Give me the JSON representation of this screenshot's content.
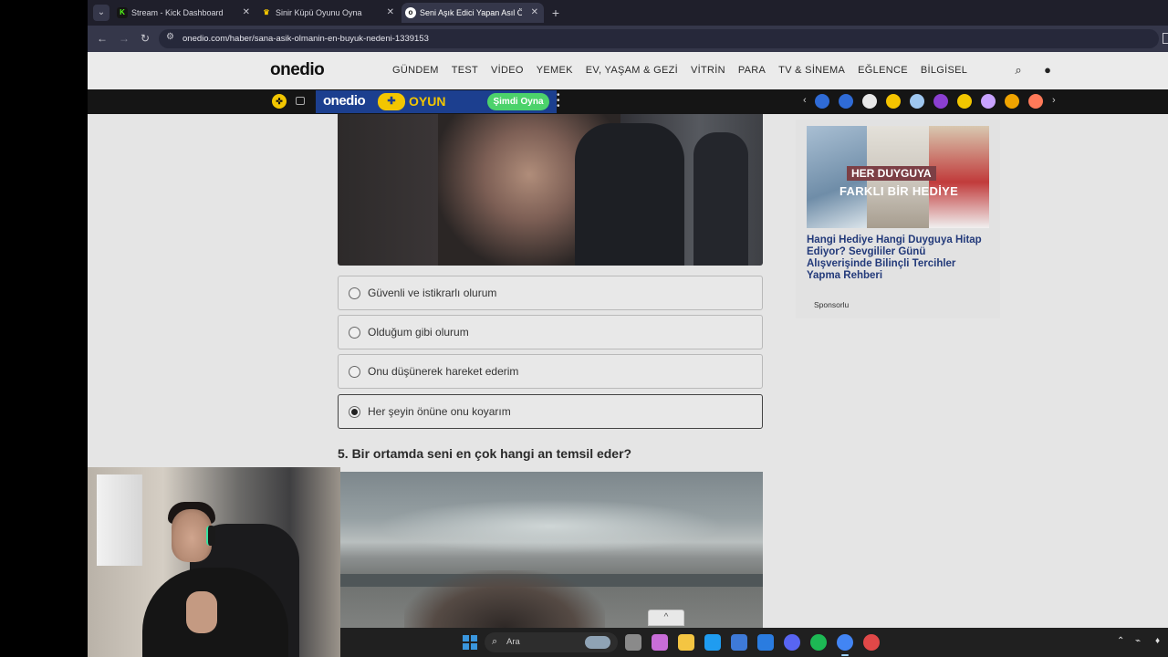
{
  "browser": {
    "tabs": [
      {
        "title": "Stream - Kick Dashboard",
        "favicon": "kick-icon",
        "favicon_color": "#53fc18",
        "active": false
      },
      {
        "title": "Sinir Küpü Oyunu Oyna",
        "favicon": "trophy-icon",
        "favicon_color": "#f2c600",
        "active": false
      },
      {
        "title": "Seni Aşık Edici Yapan Asıl Özelliğ",
        "favicon": "onedio-icon",
        "favicon_color": "#ffffff",
        "active": true
      }
    ],
    "url": "onedio.com/haber/sana-asik-olmanin-en-buyuk-nedeni-1339153"
  },
  "site": {
    "logo": "onedio",
    "nav": [
      "GÜNDEM",
      "TEST",
      "VİDEO",
      "YEMEK",
      "EV, YAŞAM & GEZİ",
      "VİTRİN",
      "PARA",
      "TV & SİNEMA",
      "EĞLENCE",
      "BİLGİSEL"
    ]
  },
  "game_bar": {
    "logo": "onedio",
    "label": "OYUN",
    "play_button": "Şimdi Oyna",
    "game_colors": [
      "#2f6bd6",
      "#2f6bd6",
      "#e8e8e8",
      "#f5c400",
      "#9fc7f0",
      "#8b3fd1",
      "#f2c600",
      "#c9a3ff",
      "#f0a400",
      "#ff7a59"
    ]
  },
  "quiz": {
    "options": [
      {
        "label": "Güvenli ve istikrarlı olurum",
        "selected": false
      },
      {
        "label": "Olduğum gibi olurum",
        "selected": false
      },
      {
        "label": "Onu düşünerek hareket ederim",
        "selected": false
      },
      {
        "label": "Her şeyin önüne onu koyarım",
        "selected": true
      }
    ],
    "next_question": "5. Bir ortamda seni en çok hangi an temsil eder?"
  },
  "ad": {
    "image_line1": "HER DUYGUYA",
    "image_line2": "FARKLI BİR HEDİYE",
    "title": "Hangi Hediye Hangi Duyguya Hitap Ediyor? Sevgililer Günü Alışverişinde Bilinçli Tercihler Yapma Rehberi",
    "sponsor": "Sponsorlu"
  },
  "taskbar": {
    "search_placeholder": "Ara",
    "app_colors": [
      "#8a8a8a",
      "#c96dd8",
      "#f4c542",
      "#1f9cf0",
      "#3e7ad8",
      "#2a7ce0",
      "#5865f2",
      "#1db954",
      "#4285f4",
      "#e04848"
    ]
  }
}
